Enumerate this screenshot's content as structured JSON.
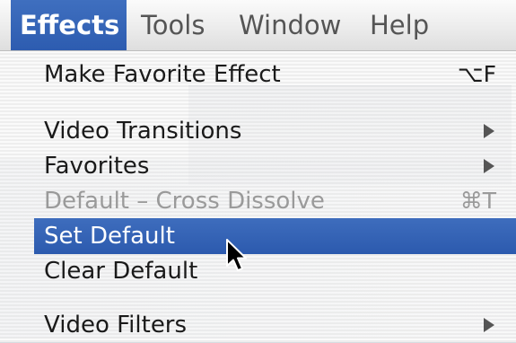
{
  "menubar": {
    "menus": [
      {
        "label": "Effects",
        "active": true
      },
      {
        "label": "Tools",
        "active": false
      },
      {
        "label": "Window",
        "active": false
      },
      {
        "label": "Help",
        "active": false
      }
    ]
  },
  "dropdown": {
    "items": [
      {
        "label": "Make Favorite Effect",
        "shortcut": "⌥F",
        "enabled": true
      },
      {
        "label": "Video Transitions",
        "submenu": true,
        "enabled": true
      },
      {
        "label": "Favorites",
        "submenu": true,
        "enabled": true
      },
      {
        "label": "Default – Cross Dissolve",
        "shortcut": "⌘T",
        "enabled": false
      },
      {
        "label": "Set Default",
        "enabled": true,
        "highlighted": true
      },
      {
        "label": "Clear Default",
        "enabled": true
      },
      {
        "label": "Video Filters",
        "submenu": true,
        "enabled": true
      }
    ]
  },
  "colors": {
    "highlight": "#2f5db1",
    "disabled_text": "#9a9a9a",
    "menu_text": "#1a1a1a"
  },
  "icons": {
    "submenu": "submenu-arrow-icon",
    "pointer": "mouse-pointer-icon"
  }
}
